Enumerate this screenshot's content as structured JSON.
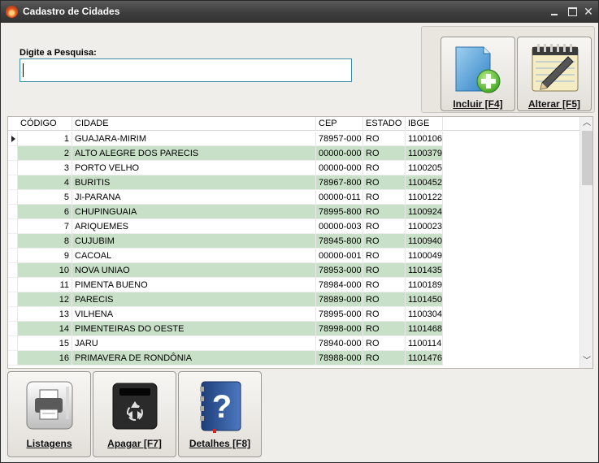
{
  "window": {
    "title": "Cadastro de Cidades",
    "minimize": "—",
    "maximize": "☐",
    "close": "✕"
  },
  "search": {
    "label": "Digite a Pesquisa:",
    "value": "",
    "placeholder": ""
  },
  "toolbar": {
    "incluir_label": "Incluir [F4]",
    "alterar_label": "Alterar [F5]",
    "listagens_label": "Listagens",
    "apagar_label": "Apagar [F7]",
    "detalhes_label": "Detalhes [F8]"
  },
  "grid": {
    "columns": [
      "CÓDIGO",
      "CIDADE",
      "CEP",
      "ESTADO",
      "IBGE"
    ],
    "rows": [
      {
        "codigo": "1",
        "cidade": "GUAJARA-MIRIM",
        "cep": "78957-000",
        "estado": "RO",
        "ibge": "1100106"
      },
      {
        "codigo": "2",
        "cidade": "ALTO ALEGRE DOS PARECIS",
        "cep": "00000-000",
        "estado": "RO",
        "ibge": "1100379"
      },
      {
        "codigo": "3",
        "cidade": "PORTO VELHO",
        "cep": "00000-000",
        "estado": "RO",
        "ibge": "1100205"
      },
      {
        "codigo": "4",
        "cidade": "BURITIS",
        "cep": "78967-800",
        "estado": "RO",
        "ibge": "1100452"
      },
      {
        "codigo": "5",
        "cidade": "JI-PARANA",
        "cep": "00000-011",
        "estado": "RO",
        "ibge": "1100122"
      },
      {
        "codigo": "6",
        "cidade": "CHUPINGUAIA",
        "cep": "78995-800",
        "estado": "RO",
        "ibge": "1100924"
      },
      {
        "codigo": "7",
        "cidade": "ARIQUEMES",
        "cep": "00000-003",
        "estado": "RO",
        "ibge": "1100023"
      },
      {
        "codigo": "8",
        "cidade": "CUJUBIM",
        "cep": "78945-800",
        "estado": "RO",
        "ibge": "1100940"
      },
      {
        "codigo": "9",
        "cidade": "CACOAL",
        "cep": "00000-001",
        "estado": "RO",
        "ibge": "1100049"
      },
      {
        "codigo": "10",
        "cidade": "NOVA UNIAO",
        "cep": "78953-000",
        "estado": "RO",
        "ibge": "1101435"
      },
      {
        "codigo": "11",
        "cidade": "PIMENTA BUENO",
        "cep": "78984-000",
        "estado": "RO",
        "ibge": "1100189"
      },
      {
        "codigo": "12",
        "cidade": "PARECIS",
        "cep": "78989-000",
        "estado": "RO",
        "ibge": "1101450"
      },
      {
        "codigo": "13",
        "cidade": "VILHENA",
        "cep": "78995-000",
        "estado": "RO",
        "ibge": "1100304"
      },
      {
        "codigo": "14",
        "cidade": "PIMENTEIRAS DO OESTE",
        "cep": "78998-000",
        "estado": "RO",
        "ibge": "1101468"
      },
      {
        "codigo": "15",
        "cidade": "JARU",
        "cep": "78940-000",
        "estado": "RO",
        "ibge": "1100114"
      },
      {
        "codigo": "16",
        "cidade": "PRIMAVERA DE RONDÔNIA",
        "cep": "78988-000",
        "estado": "RO",
        "ibge": "1101476"
      }
    ],
    "selected_row": 1
  },
  "scrollbar": {
    "up": "︿",
    "down": "﹀"
  },
  "colors": {
    "titlebar": "#3d3d3d",
    "alt_row": "#c8e0c8",
    "input_border": "#3d8fa8",
    "window_bg": "#f0eeea"
  },
  "icons": {
    "title": "app-flame-icon",
    "incluir": "folder-add-icon",
    "alterar": "notepad-pencil-icon",
    "listagens": "printer-icon",
    "apagar": "recycle-bin-icon",
    "detalhes": "help-book-icon"
  }
}
